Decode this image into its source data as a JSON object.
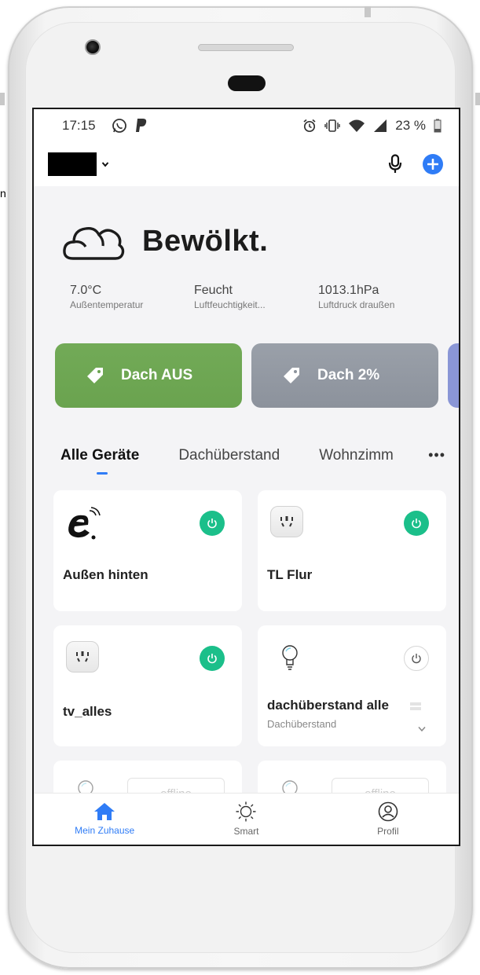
{
  "status_bar": {
    "time": "17:15",
    "battery": "23 %"
  },
  "weather": {
    "condition": "Bewölkt.",
    "stats": [
      {
        "value": "7.0°C",
        "label": "Außentemperatur"
      },
      {
        "value": "Feucht",
        "label": "Luftfeuchtigkeit..."
      },
      {
        "value": "1013.1hPa",
        "label": "Luftdruck draußen"
      }
    ]
  },
  "scenes": [
    {
      "label": "Dach AUS",
      "color": "#6aa34f"
    },
    {
      "label": "Dach 2%",
      "color": "#8c929c"
    }
  ],
  "tabs": [
    "Alle Geräte",
    "Dachüberstand",
    "Wohnzimm"
  ],
  "tab_more": "•••",
  "devices": [
    {
      "name": "Außen hinten",
      "icon": "wifi-logo-icon",
      "power": "on"
    },
    {
      "name": "TL Flur",
      "icon": "plug-icon",
      "power": "on"
    },
    {
      "name": "tv_alles",
      "icon": "plug-icon",
      "power": "on"
    },
    {
      "name": "dachüberstand alle",
      "sub": "Dachüberstand",
      "icon": "bulb-icon",
      "power": "off"
    },
    {
      "offline_label": "offline",
      "icon": "bulb-icon"
    },
    {
      "offline_label": "offline",
      "icon": "bulb-icon"
    }
  ],
  "bottom_nav": [
    {
      "label": "Mein Zuhause",
      "icon": "home-icon",
      "active": true
    },
    {
      "label": "Smart",
      "icon": "sun-icon",
      "active": false
    },
    {
      "label": "Profil",
      "icon": "profile-icon",
      "active": false
    }
  ],
  "side_text": "n",
  "colors": {
    "accent": "#2f7cf6",
    "power_on": "#1bbf8a"
  }
}
